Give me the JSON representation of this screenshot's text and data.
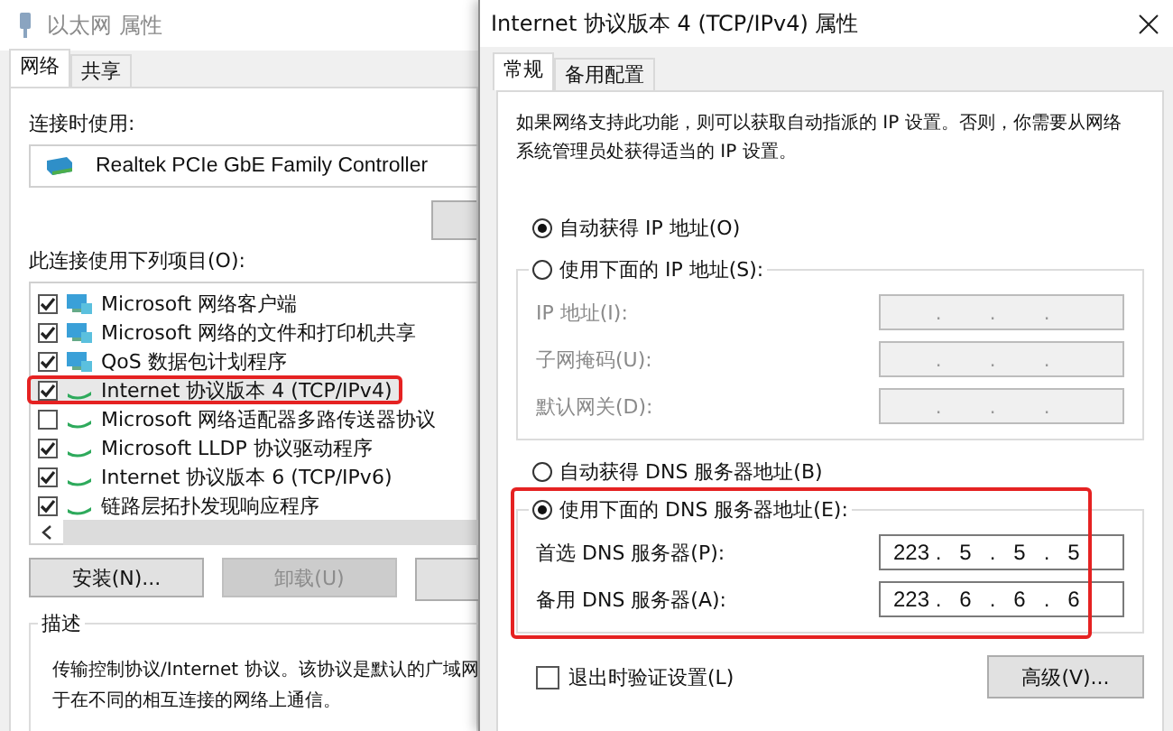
{
  "network_properties": {
    "title": "以太网 属性",
    "tabs": [
      {
        "label": "网络",
        "selected": true
      },
      {
        "label": "共享",
        "selected": false
      }
    ],
    "connect_using_label": "连接时使用:",
    "adapter": "Realtek PCIe GbE Family Controller",
    "items_label": "此连接使用下列项目(O):",
    "items": [
      {
        "label": "Microsoft 网络客户端",
        "checked": true,
        "kind": "service",
        "selected": false,
        "highlighted": false
      },
      {
        "label": "Microsoft 网络的文件和打印机共享",
        "checked": true,
        "kind": "service",
        "selected": false,
        "highlighted": false
      },
      {
        "label": "QoS 数据包计划程序",
        "checked": true,
        "kind": "service",
        "selected": false,
        "highlighted": false
      },
      {
        "label": "Internet 协议版本 4 (TCP/IPv4)",
        "checked": true,
        "kind": "protocol",
        "selected": true,
        "highlighted": true
      },
      {
        "label": "Microsoft 网络适配器多路传送器协议",
        "checked": false,
        "kind": "protocol",
        "selected": false,
        "highlighted": false
      },
      {
        "label": "Microsoft LLDP 协议驱动程序",
        "checked": true,
        "kind": "protocol",
        "selected": false,
        "highlighted": false
      },
      {
        "label": "Internet 协议版本 6 (TCP/IPv6)",
        "checked": true,
        "kind": "protocol",
        "selected": false,
        "highlighted": false
      },
      {
        "label": "链路层拓扑发现响应程序",
        "checked": true,
        "kind": "protocol",
        "selected": false,
        "highlighted": false
      }
    ],
    "buttons": [
      {
        "label": "安装(N)...",
        "disabled": false
      },
      {
        "label": "卸载(U)",
        "disabled": true
      }
    ],
    "description_title": "描述",
    "description": [
      "传输控制协议/Internet 协议。该协议是默认的广域网",
      "于在不同的相互连接的网络上通信。"
    ]
  },
  "ipv4_properties": {
    "title": "Internet 协议版本 4 (TCP/IPv4) 属性",
    "tabs": [
      {
        "label": "常规",
        "selected": true
      },
      {
        "label": "备用配置",
        "selected": false
      }
    ],
    "intro": "如果网络支持此功能，则可以获取自动指派的 IP 设置。否则，你需要从网络系统管理员处获得适当的 IP 设置。",
    "ip_auto": {
      "label": "自动获得 IP 地址(O)",
      "selected": true
    },
    "ip_manual": {
      "label": "使用下面的 IP 地址(S):",
      "selected": false
    },
    "ip_fields": [
      {
        "label": "IP 地址(I):",
        "disabled": true
      },
      {
        "label": "子网掩码(U):",
        "disabled": true
      },
      {
        "label": "默认网关(D):",
        "disabled": true
      }
    ],
    "dns_auto": {
      "label": "自动获得 DNS 服务器地址(B)",
      "selected": false
    },
    "dns_manual": {
      "label": "使用下面的 DNS 服务器地址(E):",
      "selected": true,
      "highlighted": true
    },
    "dns_fields": [
      {
        "label": "首选 DNS 服务器(P):",
        "disabled": false,
        "octets": [
          "223",
          "5",
          "5",
          "5"
        ]
      },
      {
        "label": "备用 DNS 服务器(A):",
        "disabled": false,
        "octets": [
          "223",
          "6",
          "6",
          "6"
        ]
      }
    ],
    "separator": ".",
    "validate": {
      "label": "退出时验证设置(L)",
      "checked": false
    },
    "advanced_button": "高级(V)..."
  }
}
